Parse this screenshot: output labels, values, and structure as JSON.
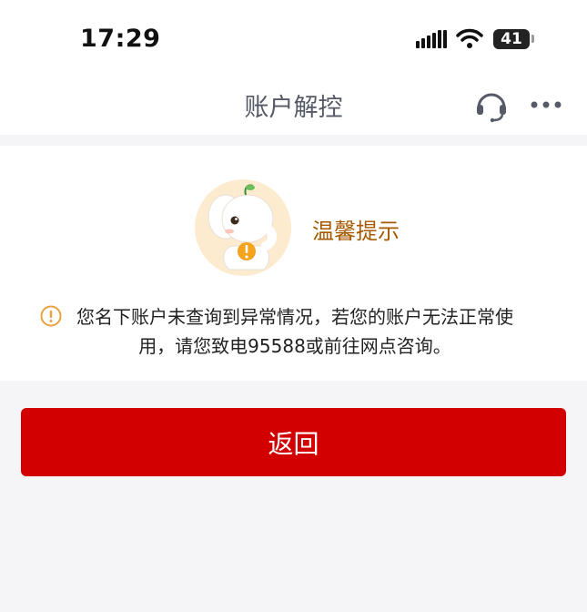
{
  "status_bar": {
    "time": "17:29",
    "battery": "41"
  },
  "nav": {
    "title": "账户解控",
    "headset_icon": "headset-icon",
    "more_icon": "more-icon"
  },
  "tip": {
    "title": "温馨提示",
    "message_line1": "您名下账户未查询到异常情况，若您的账户无法正常使",
    "message_line2": "用，请您致电95588或前往网点咨询。"
  },
  "actions": {
    "return_label": "返回"
  },
  "colors": {
    "primary_button": "#d30000",
    "tip_title": "#a65a00",
    "warning_icon": "#e8a33d"
  }
}
